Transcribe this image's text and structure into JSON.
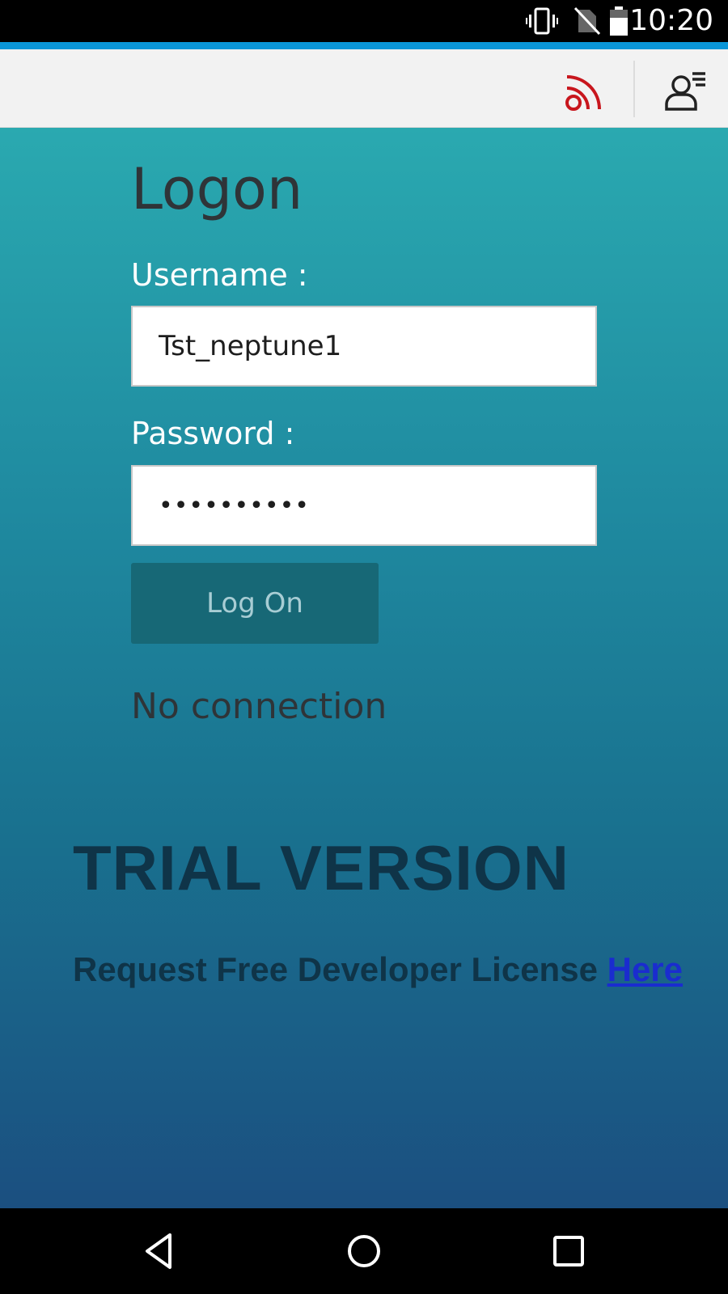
{
  "status_bar": {
    "time": "10:20",
    "icons": [
      "vibrate-icon",
      "no-sim-icon",
      "battery-icon"
    ]
  },
  "header": {
    "icons": [
      "rss-feed-icon",
      "user-menu-icon"
    ],
    "rss_icon_color": "#c8161d"
  },
  "logon": {
    "title": "Logon",
    "username_label": "Username :",
    "username_value": "Tst_neptune1",
    "password_label": "Password :",
    "password_value": "••••••••••",
    "button_label": "Log On",
    "status_message": "No connection"
  },
  "trial": {
    "title": "TRIAL VERSION",
    "license_text": "Request Free Developer License",
    "link_text": "Here"
  },
  "nav_bar": {
    "buttons": [
      "back-icon",
      "home-icon",
      "recents-icon"
    ]
  },
  "colors": {
    "accent": "#0a96d8",
    "gradient_top": "#2aa9b0",
    "gradient_bottom": "#1b4f80",
    "button_bg": "#176876",
    "link": "#1a2ccf"
  }
}
